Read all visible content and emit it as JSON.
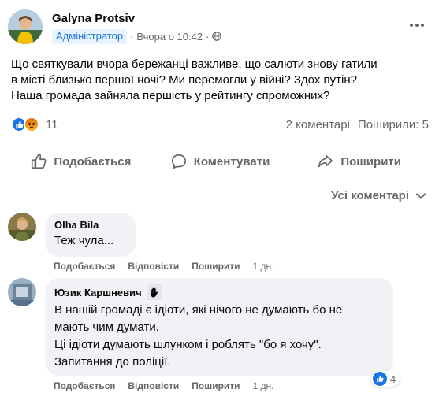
{
  "post": {
    "author": "Galyna Protsiv",
    "role": "Адміністратор",
    "separator": "·",
    "time": "Вчора о 10:42",
    "privacy_icon": "globe-icon",
    "more_icon": "more-options-icon",
    "text_lines": [
      "Що святкували вчора бережанці важливе, що салюти знову гатили",
      "в місті близько першої ночі? Ми перемогли у війні? Здох путін?",
      "Наша громада зайняла першість у рейтингу спроможних?"
    ],
    "reaction_icons": [
      "like-icon",
      "angry-icon"
    ],
    "reaction_count": "11",
    "comments_count": "2 коментарі",
    "shares_count": "Поширили: 5"
  },
  "actions": {
    "like": "Подобається",
    "comment": "Коментувати",
    "share": "Поширити"
  },
  "sort": {
    "label": "Усі коментарі",
    "icon": "chevron-down-icon"
  },
  "comments": [
    {
      "author": "Olha Bila",
      "text_lines": [
        "Теж чула..."
      ],
      "like": "Подобається",
      "reply": "Відповісти",
      "share": "Поширити",
      "time": "1 дн."
    },
    {
      "author": "Юзик Каршневич",
      "badge_icon": "waving-hand-icon",
      "text_lines": [
        "В нашій громаді є ідіоти, які нічого не думають бо не",
        "мають чим думати.",
        "Ці ідіоти думають шлунком і роблять \"бо я хочу\".",
        "Запитання до поліції."
      ],
      "reaction_count": "4",
      "like": "Подобається",
      "reply": "Відповісти",
      "share": "Поширити",
      "time": "1 дн."
    }
  ],
  "colors": {
    "accent": "#1b74e4",
    "secondary_text": "#65676b",
    "bubble_bg": "#f0f2f5",
    "badge_bg": "#e7f3ff"
  }
}
